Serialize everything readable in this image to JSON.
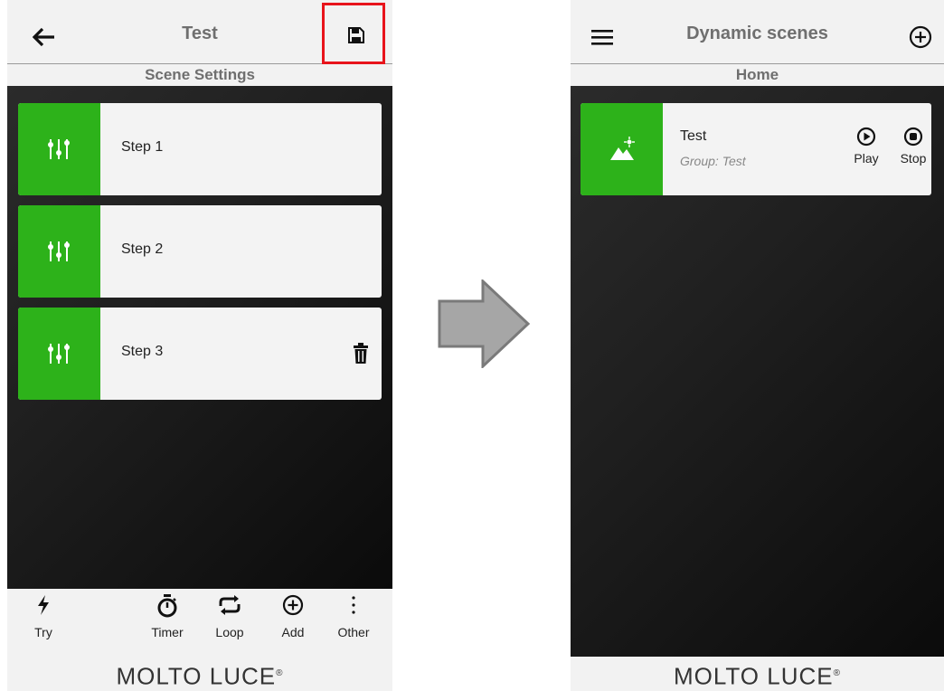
{
  "left_screen": {
    "title": "Test",
    "subtitle": "Scene Settings",
    "steps": [
      {
        "label": "Step 1"
      },
      {
        "label": "Step 2"
      },
      {
        "label": "Step 3"
      }
    ],
    "toolbar": {
      "try": "Try",
      "timer": "Timer",
      "loop": "Loop",
      "add": "Add",
      "other": "Other"
    },
    "brand": "MOLTO LUCE"
  },
  "right_screen": {
    "title": "Dynamic scenes",
    "subtitle": "Home",
    "scene": {
      "name": "Test",
      "group": "Group: Test",
      "play": "Play",
      "stop": "Stop"
    },
    "brand": "MOLTO LUCE"
  },
  "colors": {
    "accent_green": "#2db21a",
    "highlight_red": "#e8141b"
  },
  "icons": {
    "back": "arrow-left-icon",
    "save": "floppy-disk-icon",
    "step": "equalizer-sliders-icon",
    "delete": "trash-icon",
    "try": "lightning-icon",
    "timer": "stopwatch-icon",
    "loop": "repeat-icon",
    "add": "plus-circle-icon",
    "other": "vertical-dots-icon",
    "menu": "hamburger-menu-icon",
    "scene": "landscape-image-icon",
    "play": "play-circle-icon",
    "stop": "stop-circle-icon"
  }
}
